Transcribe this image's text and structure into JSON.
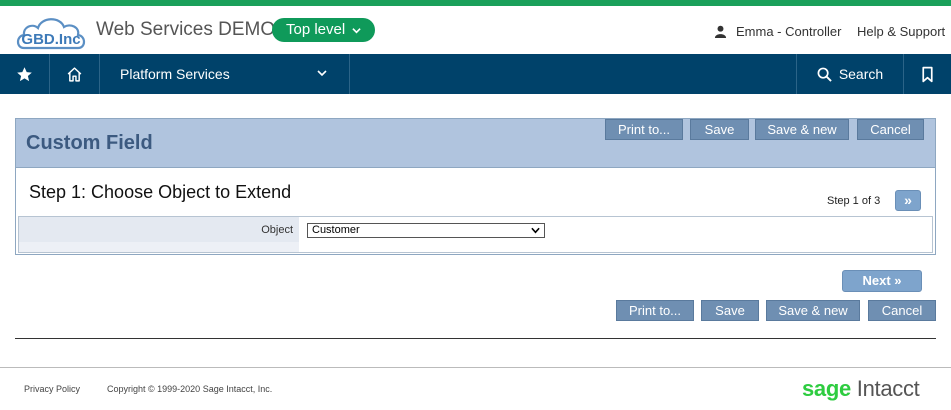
{
  "header": {
    "logo_text": "GBD.Inc",
    "app_title": "Web Services DEMO",
    "level_label": "Top level",
    "user_label": "Emma - Controller",
    "help_label": "Help & Support"
  },
  "nav": {
    "platform_label": "Platform Services",
    "search_label": "Search"
  },
  "panel": {
    "title": "Custom Field",
    "buttons": {
      "print": "Print to...",
      "save": "Save",
      "save_new": "Save & new",
      "cancel": "Cancel"
    },
    "step_title": "Step 1: Choose Object to Extend",
    "step_indicator": "Step 1 of 3",
    "step_next_glyph": "»"
  },
  "form": {
    "object_label": "Object",
    "object_value": "Customer"
  },
  "bottom": {
    "next_label": "Next  »",
    "print": "Print to...",
    "save": "Save",
    "save_new": "Save & new",
    "cancel": "Cancel"
  },
  "footer": {
    "privacy": "Privacy Policy",
    "copyright": "Copyright © 1999-2020 Sage Intacct, Inc.",
    "brand_sage": "sage",
    "brand_intacct": "Intacct"
  },
  "colors": {
    "accent_green": "#1aa05a",
    "nav_blue": "#00426a",
    "panel_header": "#b0c4de",
    "button_blue": "#6f8fb2"
  },
  "icons": [
    "cloud-logo",
    "chevron-down-icon",
    "user-icon",
    "star-icon",
    "home-icon",
    "search-icon",
    "bookmark-icon",
    "select-arrow-icon"
  ]
}
